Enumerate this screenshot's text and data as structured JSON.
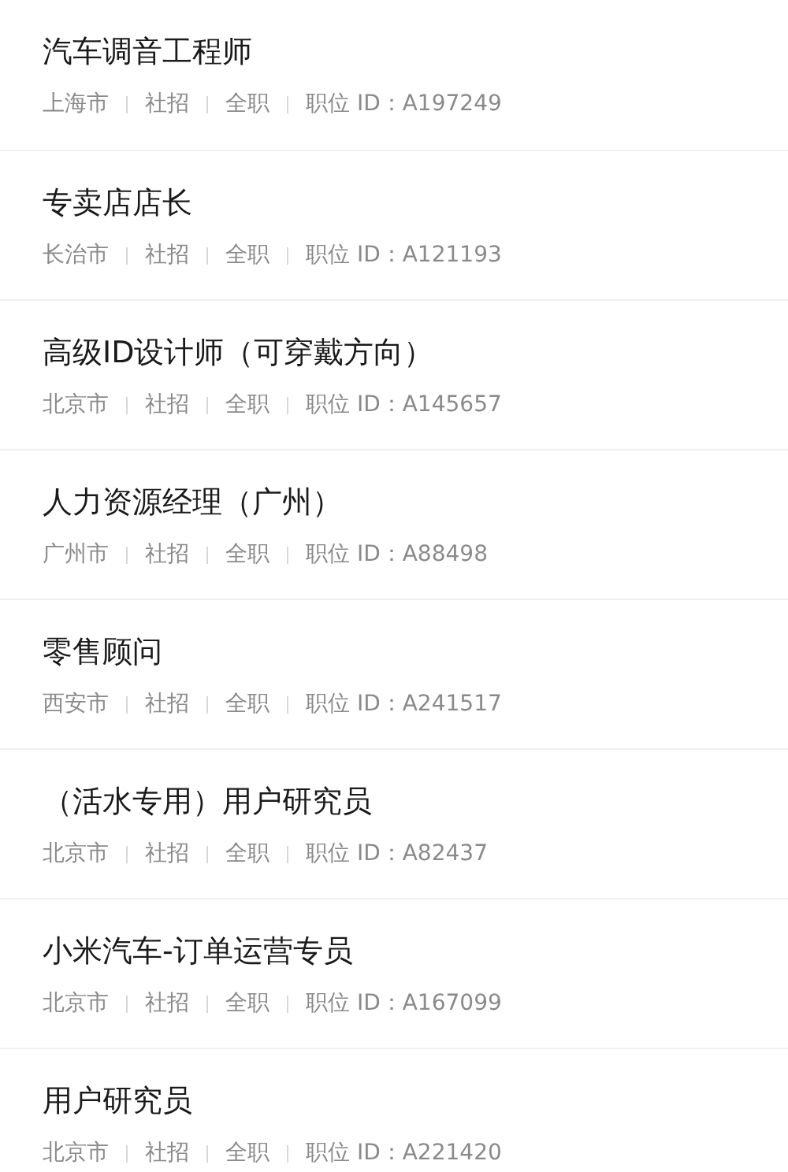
{
  "jobs": [
    {
      "title": "汽车调音工程师",
      "city": "上海市",
      "hire_type": "社招",
      "work_type": "全职",
      "job_id": "职位 ID：A197249"
    },
    {
      "title": "专卖店店长",
      "city": "长治市",
      "hire_type": "社招",
      "work_type": "全职",
      "job_id": "职位 ID：A121193"
    },
    {
      "title": "高级ID设计师（可穿戴方向）",
      "city": "北京市",
      "hire_type": "社招",
      "work_type": "全职",
      "job_id": "职位 ID：A145657"
    },
    {
      "title": "人力资源经理（广州）",
      "city": "广州市",
      "hire_type": "社招",
      "work_type": "全职",
      "job_id": "职位 ID：A88498"
    },
    {
      "title": "零售顾问",
      "city": "西安市",
      "hire_type": "社招",
      "work_type": "全职",
      "job_id": "职位 ID：A241517"
    },
    {
      "title": "（活水专用）用户研究员",
      "city": "北京市",
      "hire_type": "社招",
      "work_type": "全职",
      "job_id": "职位 ID：A82437"
    },
    {
      "title": "小米汽车-订单运营专员",
      "city": "北京市",
      "hire_type": "社招",
      "work_type": "全职",
      "job_id": "职位 ID：A167099"
    },
    {
      "title": "用户研究员",
      "city": "北京市",
      "hire_type": "社招",
      "work_type": "全职",
      "job_id": "职位 ID：A221420"
    }
  ]
}
